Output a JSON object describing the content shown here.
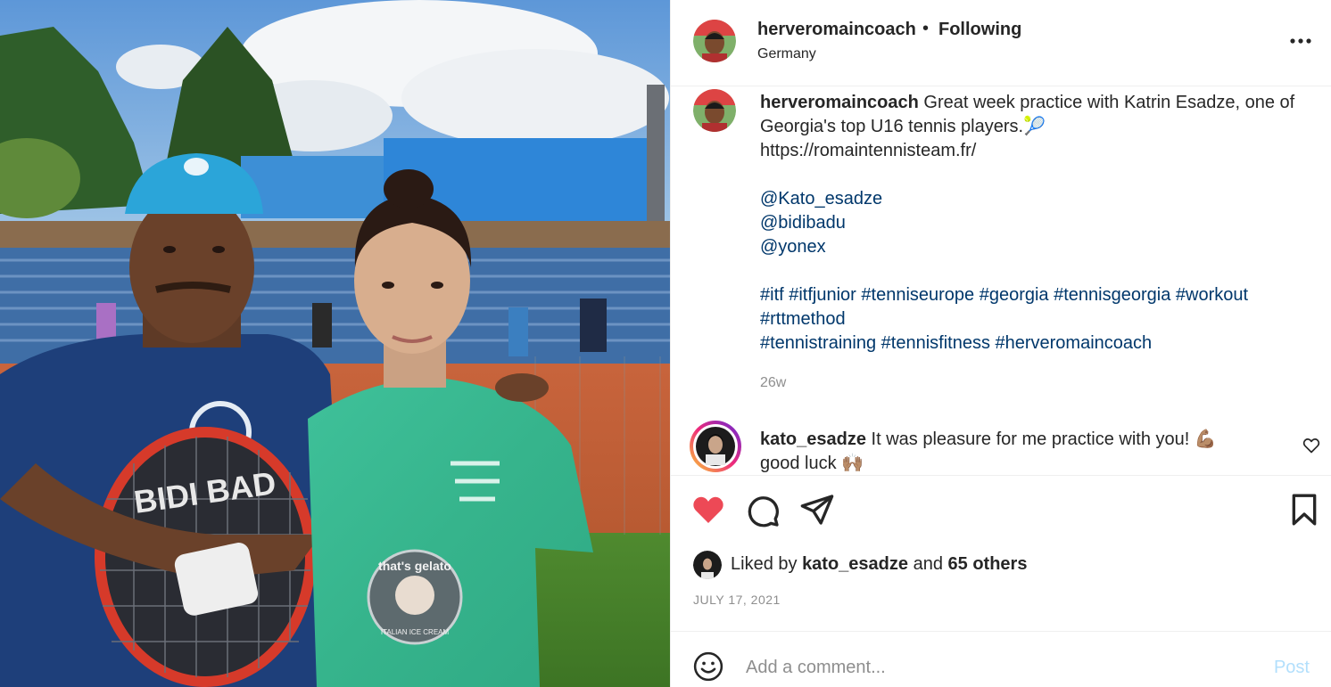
{
  "header": {
    "username": "herveromaincoach",
    "separator": "•",
    "follow_state": "Following",
    "location": "Germany",
    "more_icon": "more-horizontal-icon"
  },
  "caption": {
    "username": "herveromaincoach",
    "text_line1": "Great week practice with Katrin Esadze, one of Georgia's top U16 tennis players.",
    "emoji": "🎾",
    "link": "https://romaintennisteam.fr/",
    "mentions": [
      "@Kato_esadze",
      "@bidibadu",
      "@yonex"
    ],
    "hashtags_line1": "#itf #itfjunior #tenniseurope #georgia #tennisgeorgia #workout",
    "hashtags_line2": "#rttmethod",
    "hashtags_line3": "#tennistraining #tennisfitness #herveromaincoach",
    "time_ago": "26w"
  },
  "comment": {
    "username": "kato_esadze",
    "text": "It was pleasure for me practice with you! 💪🏽 good luck 🙌🏽"
  },
  "actions": {
    "like_icon": "heart-filled-icon",
    "comment_icon": "comment-icon",
    "share_icon": "share-icon",
    "save_icon": "bookmark-icon",
    "like_color": "#ed4956"
  },
  "likes": {
    "prefix": "Liked by",
    "user": "kato_esadze",
    "and": "and",
    "others": "65 others"
  },
  "date": "JULY 17, 2021",
  "comment_box": {
    "placeholder": "Add a comment...",
    "post_label": "Post",
    "post_color": "#b2dffc"
  },
  "photo": {
    "racket_text": "BIDI BAD",
    "shirt_print_top": "that's gelato",
    "shirt_print_bottom": "ITALIAN ICE CREAM"
  }
}
